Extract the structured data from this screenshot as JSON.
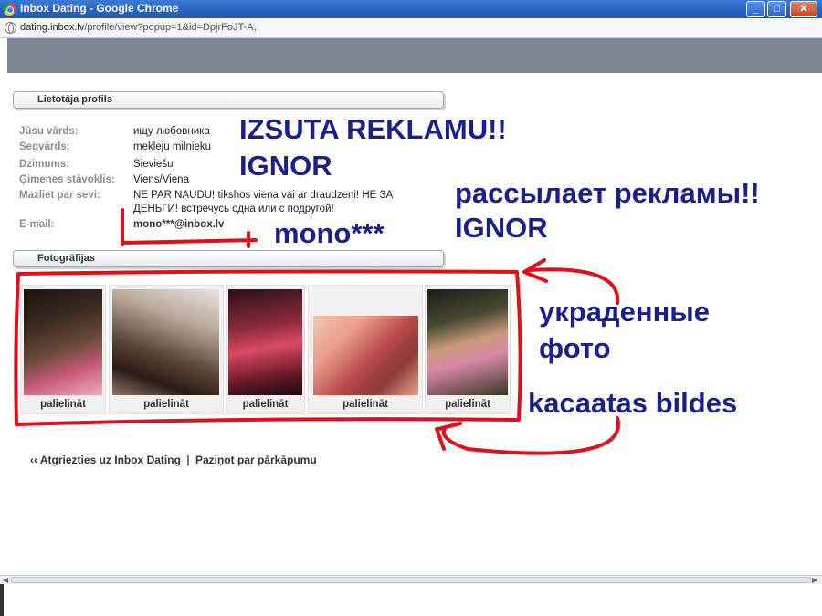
{
  "window": {
    "title": "Inbox Dating - Google Chrome",
    "controls": {
      "minimize": "_",
      "maximize": "□",
      "close": "✕"
    }
  },
  "address_bar": {
    "host": "dating.inbox.lv",
    "path": "/profile/view?popup=1&id=DpjrFoJT-A,,"
  },
  "profile": {
    "section_title": "Lietotāja profils",
    "fields": [
      {
        "label": "Jūsu vārds:",
        "value": "ищу любовника"
      },
      {
        "label": "Segvārds:",
        "value": "mekleju milnieku"
      },
      {
        "label": "Dzimums:",
        "value": "Sieviešu"
      },
      {
        "label": "Ģimenes stāvoklis:",
        "value": "Viens/Viena"
      },
      {
        "label": "Mazliet par sevi:",
        "value_line1": "NE PAR NAUDU! tikshos viena vai ar draudzeni! НЕ ЗА",
        "value_line2": "ДЕНЬГИ! встречусь одна или с подругой!"
      },
      {
        "label": "E-mail:",
        "value": "mono***@inbox.lv"
      }
    ]
  },
  "photos": {
    "section_title": "Fotogrāfijas",
    "items": [
      {
        "link": "palielināt"
      },
      {
        "link": "palielināt"
      },
      {
        "link": "palielināt"
      },
      {
        "link": "palielināt"
      },
      {
        "link": "palielināt"
      }
    ]
  },
  "footer": {
    "prefix": "‹‹",
    "back_link": "Atgriezties uz Inbox Dating",
    "separator": "|",
    "report_link": "Paziņot par pārkāpumu"
  },
  "annotations": {
    "izsuta": "IZSUTA REKLAMU!!",
    "ignor1": "IGNOR",
    "rassylaet": "рассылает рекламы!!",
    "ignor2": "IGNOR",
    "mono": "mono***",
    "ukradennye1": "украденные",
    "ukradennye2": "фото",
    "kacaatas": "kacaatas bildes"
  },
  "colors": {
    "annotation_text": "#1b1f8c",
    "annotation_marker": "#e0101a",
    "header_bar": "#7c8893"
  }
}
